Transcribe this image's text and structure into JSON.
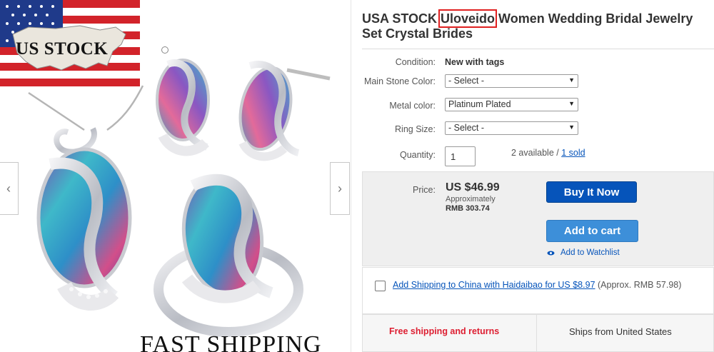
{
  "gallery": {
    "badge_text": "US STOCK",
    "footer_text": "FAST SHIPPING",
    "prev_arrow": "‹",
    "next_arrow": "›"
  },
  "item": {
    "title_prefix": "USA STOCK ",
    "title_brand": "Uloveido",
    "title_suffix": " Women Wedding Bridal Jewelry Set Crystal Brides"
  },
  "specifics": {
    "condition_label": "Condition:",
    "condition_value": "New with tags",
    "stone_label": "Main Stone Color:",
    "stone_value": "- Select -",
    "metal_label": "Metal color:",
    "metal_value": "Platinum Plated",
    "ring_label": "Ring Size:",
    "ring_value": "- Select -",
    "quantity_label": "Quantity:",
    "quantity_value": "1",
    "available_text": "2 available / ",
    "sold_text": "1 sold"
  },
  "price": {
    "label": "Price:",
    "value": "US $46.99",
    "approx_label": "Approximately",
    "rmb_value": "RMB 303.74",
    "buy_now": "Buy It Now",
    "add_to_cart": "Add to cart",
    "watchlist": "Add to Watchlist"
  },
  "addon": {
    "link_text": "Add Shipping to China with Haidaibao for US $8.97",
    "rest_text": " (Approx. RMB 57.98)"
  },
  "shipping": {
    "free": "Free shipping and returns",
    "from": "Ships from United States"
  },
  "colors": {
    "primary_button": "#0654ba",
    "secondary_button": "#3d8fd9",
    "highlight_box": "#e02020",
    "free_shipping": "#dd1e31"
  }
}
